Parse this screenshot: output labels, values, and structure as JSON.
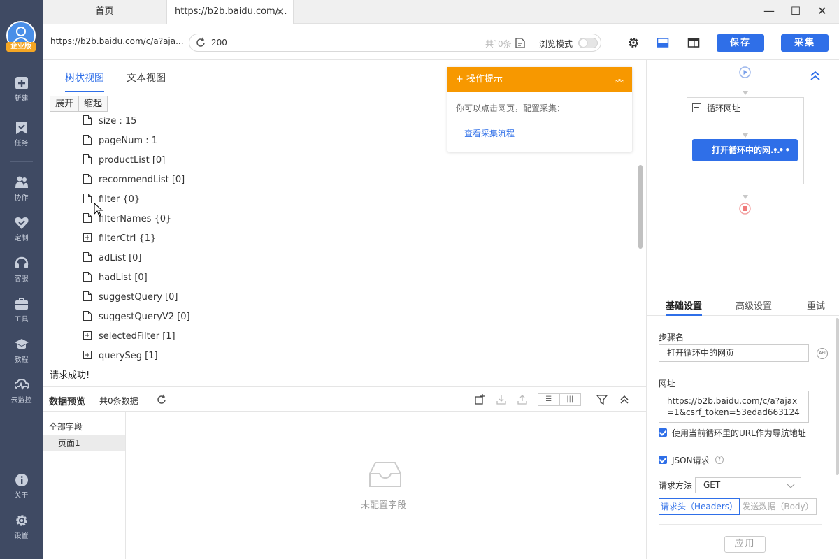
{
  "app": {
    "badge": "企业版",
    "sidebar": [
      {
        "label": "新建",
        "icon": "plus-square-icon"
      },
      {
        "label": "任务",
        "icon": "bookmark-icon"
      },
      {
        "label": "协作",
        "icon": "people-icon"
      },
      {
        "label": "定制",
        "icon": "heart-check-icon"
      },
      {
        "label": "客服",
        "icon": "headset-icon"
      },
      {
        "label": "工具",
        "icon": "toolbox-icon"
      },
      {
        "label": "教程",
        "icon": "graduation-cap-icon"
      },
      {
        "label": "云监控",
        "icon": "pulse-icon"
      },
      {
        "label": "关于",
        "icon": "info-icon"
      },
      {
        "label": "设置",
        "icon": "gear-icon"
      }
    ]
  },
  "tabs": {
    "home": "首页",
    "active": "https://b2b.baidu.com/..."
  },
  "address": {
    "url_short": "https://b2b.baidu.com/c/a?aja...",
    "request_value": "200",
    "count_text": "共`0条",
    "browse_mode": "浏览模式",
    "save": "保存",
    "collect": "采集"
  },
  "tree": {
    "tab_tree": "树状视图",
    "tab_text": "文本视图",
    "expand": "展开",
    "collapse": "缩起",
    "nodes": [
      {
        "label": "size : 15",
        "type": "leaf"
      },
      {
        "label": "pageNum : 1",
        "type": "leaf"
      },
      {
        "label": "productList [0]",
        "type": "leaf"
      },
      {
        "label": "recommendList [0]",
        "type": "leaf"
      },
      {
        "label": "filter {0}",
        "type": "leaf"
      },
      {
        "label": "filterNames {0}",
        "type": "leaf"
      },
      {
        "label": "filterCtrl {1}",
        "type": "expandable"
      },
      {
        "label": "adList [0]",
        "type": "leaf"
      },
      {
        "label": "hadList [0]",
        "type": "leaf"
      },
      {
        "label": "suggestQuery [0]",
        "type": "leaf"
      },
      {
        "label": "suggestQueryV2 [0]",
        "type": "leaf"
      },
      {
        "label": "selectedFilter [1]",
        "type": "expandable"
      },
      {
        "label": "querySeg [1]",
        "type": "expandable"
      }
    ],
    "status": "请求成功!"
  },
  "hint": {
    "title": "操作提示",
    "text": "你可以点击网页，配置采集：",
    "link": "查看采集流程"
  },
  "preview": {
    "title": "数据预览",
    "count": "共0条数据",
    "all_fields": "全部字段",
    "page": "页面1",
    "empty": "未配置字段"
  },
  "flow": {
    "loop_label": "循环网址",
    "step_label": "打开循环中的网...",
    "step_more": "•••"
  },
  "settings": {
    "tabs": [
      "基础设置",
      "高级设置",
      "重试"
    ],
    "step_name_label": "步骤名",
    "step_name_value": "打开循环中的网页",
    "api_icon": "API",
    "url_label": "网址",
    "url_value": "https://b2b.baidu.com/c/a?ajax=1&csrf_token=53edad663124",
    "use_loop_url": "使用当前循环里的URL作为导航地址",
    "json_request": "JSON请求",
    "method_label": "请求方法",
    "method_value": "GET",
    "headers_tab": "请求头（Headers）",
    "body_tab": "发送数据（Body）",
    "apply": "应用"
  },
  "colors": {
    "sidebar": "#3f4a63",
    "primary": "#2f6fe8",
    "hint_orange": "#f79800"
  }
}
